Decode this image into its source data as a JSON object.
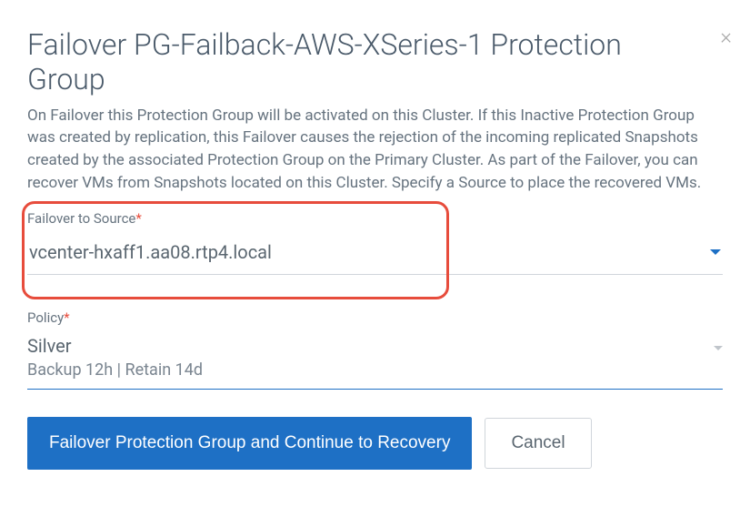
{
  "modal": {
    "title": "Failover PG-Failback-AWS-XSeries-1 Protection Group",
    "description": "On Failover this Protection Group will be activated on this Cluster. If this Inactive Protection Group was created by replication, this Failover causes the rejection of the incoming replicated Snapshots created by the associated Protection Group on the Primary Cluster. As part of the Failover, you can recover VMs from Snapshots located on this Cluster. Specify a Source to place the recovered VMs.",
    "close_label": "×"
  },
  "fields": {
    "source": {
      "label": "Failover to Source",
      "required_marker": "*",
      "value": "vcenter-hxaff1.aa08.rtp4.local"
    },
    "policy": {
      "label": "Policy",
      "required_marker": "*",
      "value": "Silver",
      "detail": "Backup 12h | Retain 14d"
    }
  },
  "buttons": {
    "primary": "Failover Protection Group and Continue to Recovery",
    "cancel": "Cancel"
  }
}
